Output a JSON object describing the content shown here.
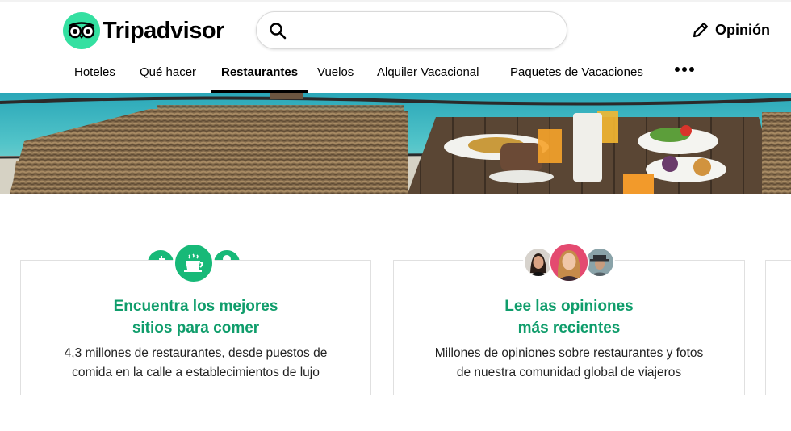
{
  "header": {
    "logo_text": "Tripadvisor",
    "search_placeholder": "",
    "review_label": "Opinión"
  },
  "nav": {
    "items": [
      {
        "label": "Hoteles"
      },
      {
        "label": "Qué hacer"
      },
      {
        "label": "Restaurantes",
        "active": true
      },
      {
        "label": "Vuelos"
      },
      {
        "label": "Alquiler Vacacional"
      },
      {
        "label": "Paquetes de Vacaciones"
      }
    ],
    "more_icon": "more-dots-icon"
  },
  "cards": [
    {
      "title_line1": "Encuentra los mejores",
      "title_line2": "sitios para comer",
      "desc_line1": "4,3 millones de restaurantes, desde puestos de",
      "desc_line2": "comida en la calle a establecimientos de lujo",
      "icons": [
        "drink-icon",
        "coffee-cup-icon",
        "ice-cream-icon"
      ]
    },
    {
      "title_line1": "Lee las opiniones",
      "title_line2": "más recientes",
      "desc_line1": "Millones de opiniones sobre restaurantes y fotos",
      "desc_line2": "de nuestra comunidad global de viajeros",
      "icons": [
        "avatar-woman-icon",
        "avatar-blonde-woman-icon",
        "avatar-man-hat-icon"
      ]
    }
  ],
  "colors": {
    "brand_green": "#34e0a1",
    "title_green": "#0f9d6b",
    "icon_green": "#17b978"
  }
}
